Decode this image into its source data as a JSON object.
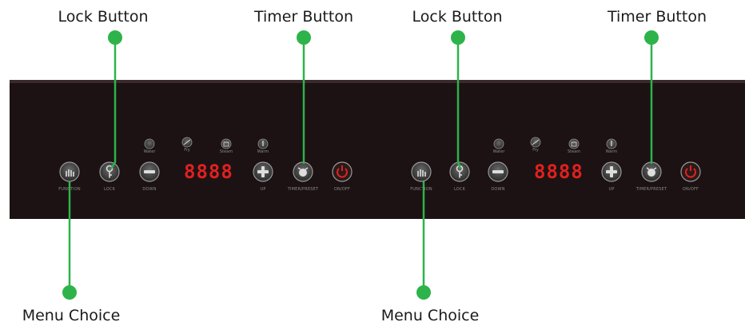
{
  "callouts": {
    "lock_button": "Lock Button",
    "timer_button": "Timer Button",
    "menu_choice": "Menu Choice"
  },
  "panel": {
    "display_value": "8888",
    "buttons": {
      "function": "FUNCTION",
      "lock": "LOCK",
      "down": "DOWN",
      "up": "UP",
      "timer": "TIMER/PRESET",
      "power": "ON/OFF"
    },
    "modes": {
      "water": "Water",
      "fry": "Fry",
      "steam": "Steam",
      "warm": "Warm"
    }
  },
  "colors": {
    "callout_line": "#2db34a",
    "panel": "#1c1213",
    "display": "#e02020",
    "power_icon": "#e02020"
  }
}
